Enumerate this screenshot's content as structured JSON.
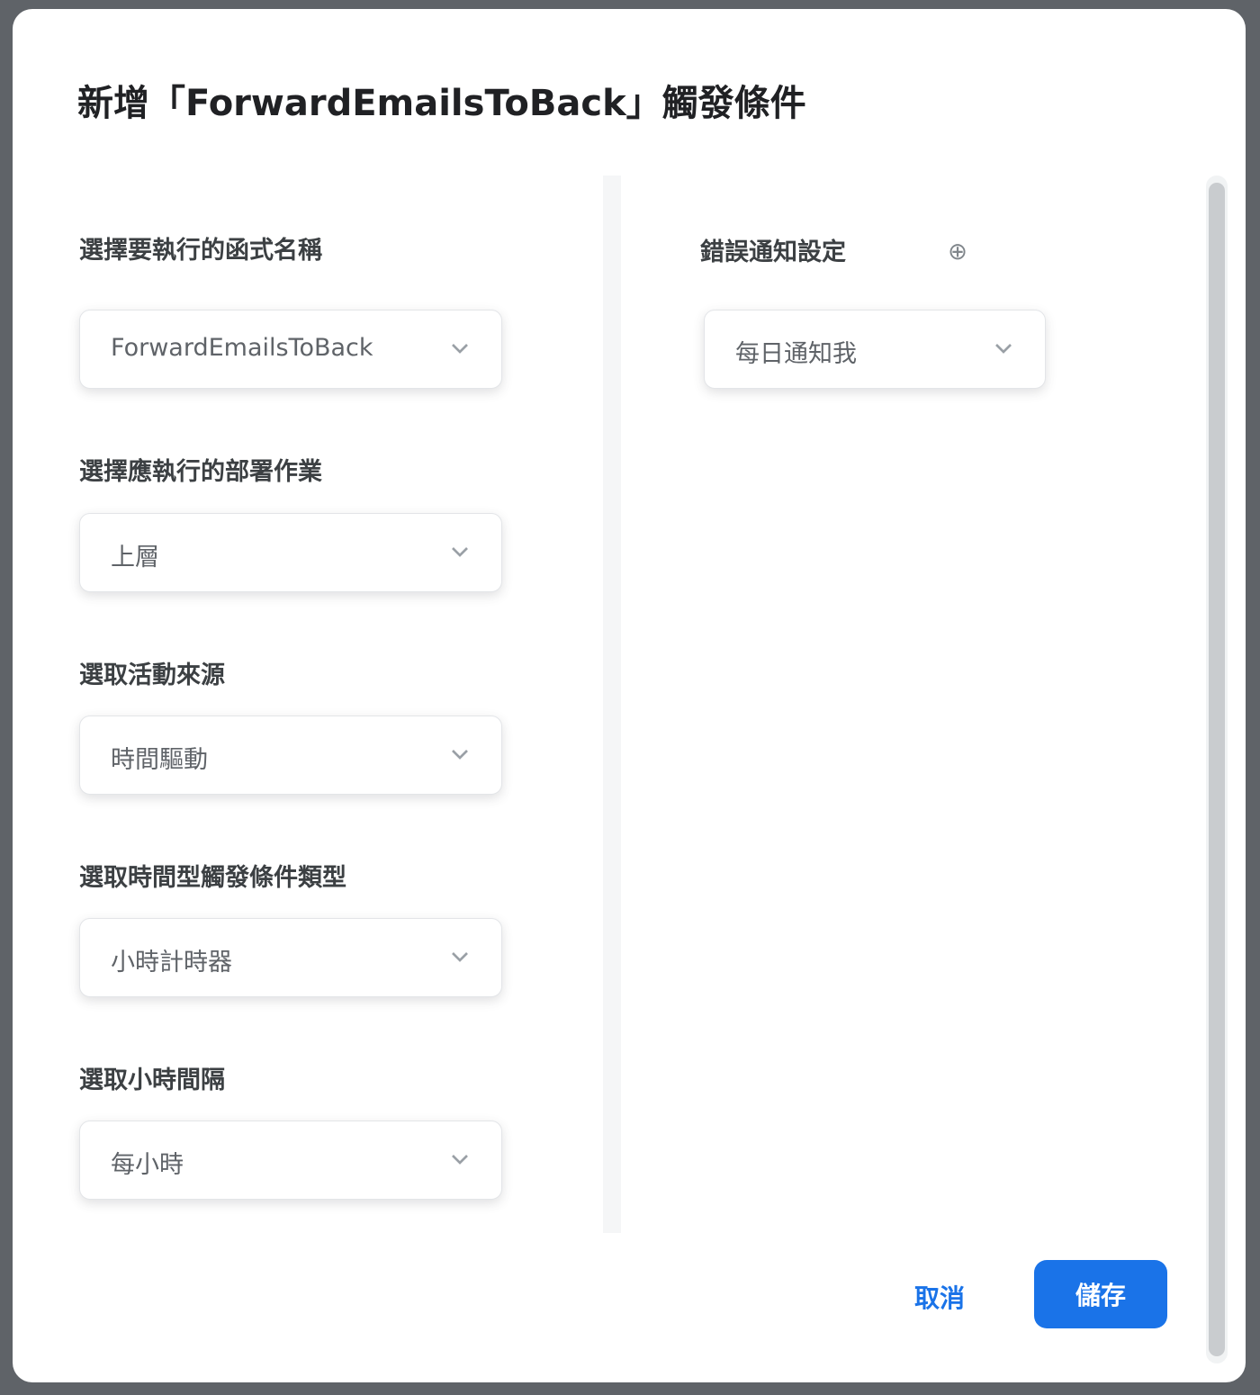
{
  "dialog": {
    "title": "新增「ForwardEmailsToBack」觸發條件"
  },
  "fields": [
    {
      "label": "選擇要執行的函式名稱",
      "value": "ForwardEmailsToBack"
    },
    {
      "label": "選擇應執行的部署作業",
      "value": "上層"
    },
    {
      "label": "選取活動來源",
      "value": "時間驅動"
    },
    {
      "label": "選取時間型觸發條件類型",
      "value": "小時計時器"
    },
    {
      "label": "選取小時間隔",
      "value": "每小時"
    }
  ],
  "notification": {
    "label": "錯誤通知設定",
    "value": "每日通知我",
    "help_icon": "help-icon"
  },
  "buttons": {
    "cancel": "取消",
    "confirm": "儲存"
  },
  "colors": {
    "accent": "#1a73e8",
    "overlay": "#5f6368"
  }
}
